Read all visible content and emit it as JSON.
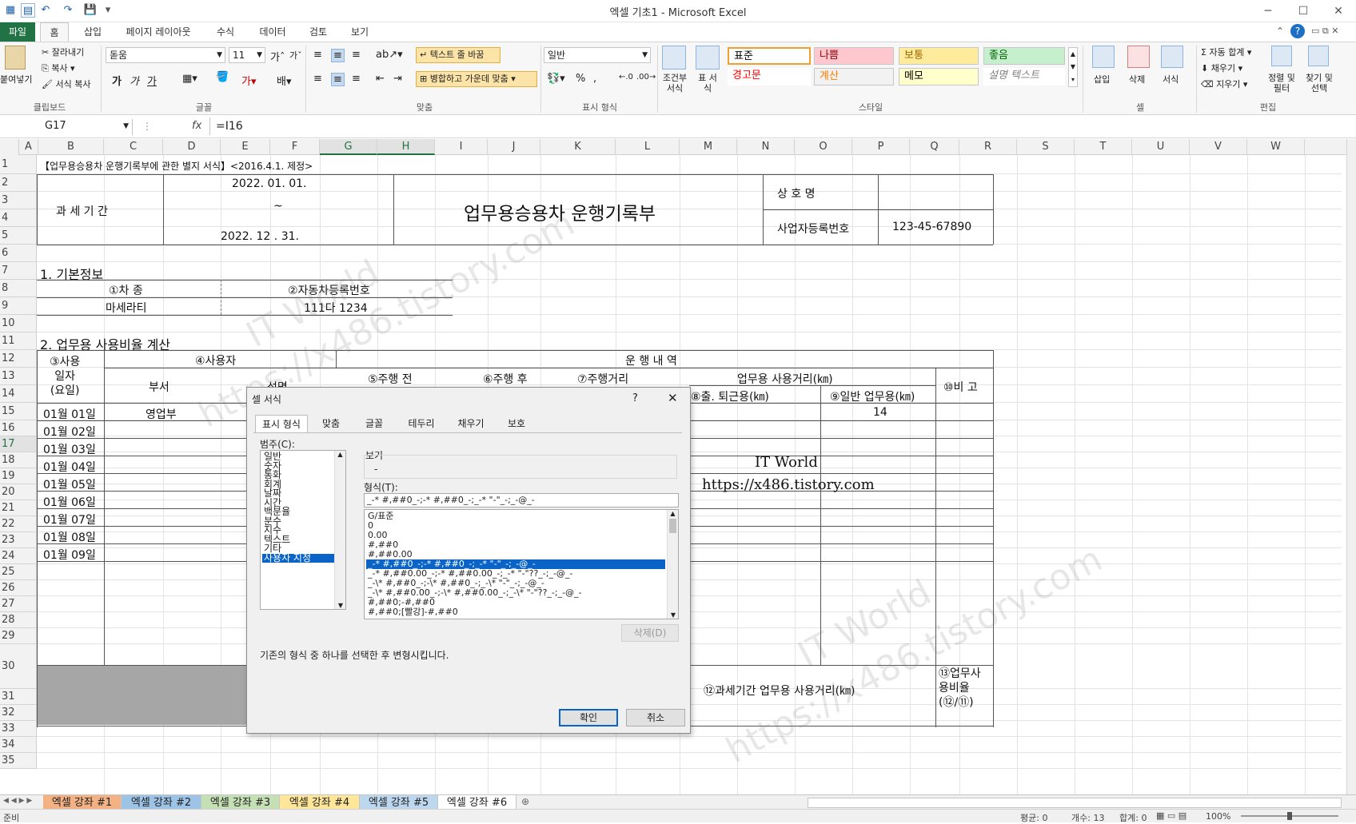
{
  "window": {
    "title": "엑셀 기초1 - Microsoft Excel",
    "minimize": "─",
    "maximize": "☐",
    "close": "✕",
    "help": "?"
  },
  "ribbon_tabs": [
    "파일",
    "홈",
    "삽입",
    "페이지 레이아웃",
    "수식",
    "데이터",
    "검토",
    "보기"
  ],
  "ribbon": {
    "clipboard": {
      "label": "클립보드",
      "paste": "붙여넣기",
      "cut": "잘라내기",
      "copy": "복사",
      "format_painter": "서식 복사"
    },
    "font": {
      "label": "글꼴",
      "name": "돋움",
      "size": "11",
      "bold": "가",
      "italic": "가",
      "underline": "가"
    },
    "alignment": {
      "label": "맞춤",
      "wrap_text": "텍스트 줄 바꿈",
      "merge_center": "병합하고 가운데 맞춤"
    },
    "number": {
      "label": "표시 형식",
      "format": "일반",
      "percent": "%",
      "comma": ","
    },
    "styles": {
      "label": "스타일",
      "conditional": "조건부 서식",
      "table": "표 서식",
      "cells": [
        {
          "name": "표준",
          "bg": "#ffffff",
          "fg": "#000000"
        },
        {
          "name": "나쁨",
          "bg": "#ffc7ce",
          "fg": "#9c0006"
        },
        {
          "name": "보통",
          "bg": "#ffeb9c",
          "fg": "#9c6500"
        },
        {
          "name": "좋음",
          "bg": "#c6efce",
          "fg": "#006100"
        },
        {
          "name": "경고문",
          "bg": "#ffffff",
          "fg": "#ff0000"
        },
        {
          "name": "계산",
          "bg": "#f2f2f2",
          "fg": "#fa7d00"
        },
        {
          "name": "메모",
          "bg": "#ffffcc",
          "fg": "#000000"
        },
        {
          "name": "설명 텍스트",
          "bg": "#ffffff",
          "fg": "#7f7f7f"
        }
      ]
    },
    "cells": {
      "label": "셀",
      "insert": "삽입",
      "delete": "삭제",
      "format": "서식"
    },
    "editing": {
      "label": "편집",
      "autosum": "자동 합계",
      "fill": "채우기",
      "clear": "지우기",
      "sort_filter": "정렬 및 필터",
      "find_select": "찾기 및 선택"
    }
  },
  "formula_bar": {
    "name_box": "G17",
    "fx": "fx",
    "formula": "=I16"
  },
  "columns": [
    "A",
    "B",
    "C",
    "D",
    "E",
    "F",
    "G",
    "H",
    "I",
    "J",
    "K",
    "L",
    "M",
    "N",
    "O",
    "P",
    "Q",
    "R",
    "S",
    "T",
    "U",
    "V",
    "W"
  ],
  "rows": [
    "1",
    "2",
    "3",
    "4",
    "5",
    "6",
    "7",
    "8",
    "9",
    "10",
    "11",
    "12",
    "13",
    "14",
    "15",
    "16",
    "17",
    "18",
    "19",
    "20",
    "21",
    "22",
    "23",
    "24",
    "25",
    "26",
    "27",
    "28",
    "29",
    "30",
    "31",
    "32",
    "33",
    "34",
    "35"
  ],
  "sheet": {
    "header_note": "【업무용승용차 운행기록부에 관한 별지 서식】<2016.4.1. 제정>",
    "period_label": "과  세  기  간",
    "period_start": "2022.  01.  01.",
    "period_tilde": "~",
    "period_end": "2022.   12 .   31.",
    "main_title": "업무용승용차 운행기록부",
    "company_label": "상    호    명",
    "bizno_label": "사업자등록번호",
    "bizno_value": "123-45-67890",
    "section1": "1. 기본정보",
    "car_type_label": "①차 종",
    "car_no_label": "②자동차등록번호",
    "car_type": "마세라티",
    "car_no": "111다 1234",
    "section2": "2. 업무용 사용비율 계산",
    "use_date_label": "③사용\n일자\n(요일)",
    "user_label": "④사용자",
    "dept_label": "부서",
    "name_label": "성명",
    "drive_log_label": "운 행    내 역",
    "before_label": "⑤주행 전",
    "after_label": "⑥주행 후",
    "distance_label": "⑦주행거리",
    "biz_distance_label": "업무용 사용거리(㎞)",
    "commute_label": "⑧출. 퇴근용(㎞)",
    "general_label": "⑨일반 업무용(㎞)",
    "note_label": "⑩비 고",
    "dates": [
      "01월 01일",
      "01월 02일",
      "01월 03일",
      "01월 04일",
      "01월 05일",
      "01월 06일",
      "01월 07일",
      "01월 08일",
      "01월 09일"
    ],
    "first_dept": "영업부",
    "first_general": "14",
    "period_biz_label": "⑫과세기간 업무용 사용거리(㎞)",
    "biz_ratio_label": "⑬업무사\n용비율\n(⑫/⑪)",
    "watermark_1": "IT World",
    "watermark_2": "https://x486.tistory.com"
  },
  "dialog": {
    "title": "셀 서식",
    "help": "?",
    "close": "✕",
    "tabs": [
      "표시 형식",
      "맞춤",
      "글꼴",
      "테두리",
      "채우기",
      "보호"
    ],
    "category_label": "범주(C):",
    "categories": [
      "일반",
      "숫자",
      "통화",
      "회계",
      "날짜",
      "시간",
      "백분율",
      "분수",
      "지수",
      "텍스트",
      "기타",
      "사용자 지정"
    ],
    "selected_category": "사용자 지정",
    "sample_label": "보기",
    "sample_value": "-",
    "type_label": "형식(T):",
    "type_value": "_-* #,##0_-;-* #,##0_-;_-* \"-\"_-;_-@_-",
    "formats": [
      "G/표준",
      "0",
      "0.00",
      "#,##0",
      "#,##0.00",
      "_-* #,##0_-;-* #,##0_-;_-* \"-\"_-;_-@_-",
      "_-* #,##0.00_-;-* #,##0.00_-;_-* \"-\"??_-;_-@_-",
      "_-\\* #,##0_-;-\\* #,##0_-;_-\\* \"-\"_-;_-@_-",
      "_-\\* #,##0.00_-;-\\* #,##0.00_-;_-\\* \"-\"??_-;_-@_-",
      "#,##0;-#,##0",
      "#,##0;[빨강]-#,##0"
    ],
    "selected_format_index": 5,
    "delete_button": "삭제(D)",
    "description": "기존의 형식 중 하나를 선택한 후 변형시킵니다.",
    "ok": "확인",
    "cancel": "취소"
  },
  "sheet_tabs": [
    {
      "name": "엑셀 강좌 #1",
      "color": "#f4b183"
    },
    {
      "name": "엑셀 강좌 #2",
      "color": "#9dc3e6"
    },
    {
      "name": "엑셀 강좌 #3",
      "color": "#c5e0b4"
    },
    {
      "name": "엑셀 강좌 #4",
      "color": "#ffe699"
    },
    {
      "name": "엑셀 강좌 #5",
      "color": "#bdd7ee"
    },
    {
      "name": "엑셀 강좌 #6",
      "color": "#ffffff"
    }
  ],
  "status": {
    "ready": "준비",
    "average": "평균: 0",
    "count": "개수: 13",
    "sum": "합계: 0",
    "zoom": "100%"
  }
}
